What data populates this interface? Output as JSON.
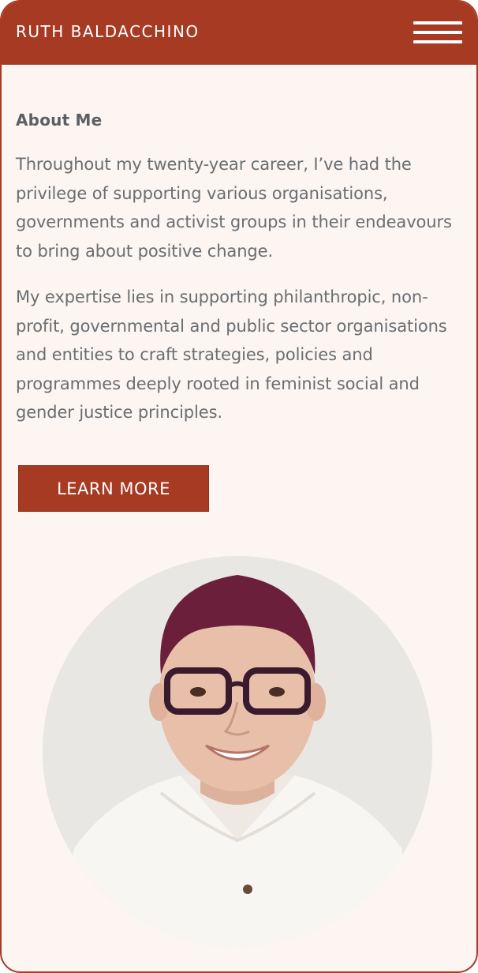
{
  "header": {
    "site_title": "RUTH BALDACCHINO",
    "menu_icon": "hamburger-menu-icon"
  },
  "about": {
    "heading": "About Me",
    "paragraphs": [
      "Throughout my twenty-year career, I’ve had the privilege of supporting various organisations, governments and activist groups in their endeavours to bring about positive change.",
      "My expertise lies in supporting philanthropic, non-profit, governmental and public sector organisations and entities to craft strategies, policies and programmes deeply rooted in feminist social and gender justice principles."
    ],
    "cta_label": "LEARN MORE"
  },
  "colors": {
    "brand": "#a63a23",
    "background": "#fcf5f1",
    "text": "#6a6d72",
    "heading": "#5b5f64"
  }
}
